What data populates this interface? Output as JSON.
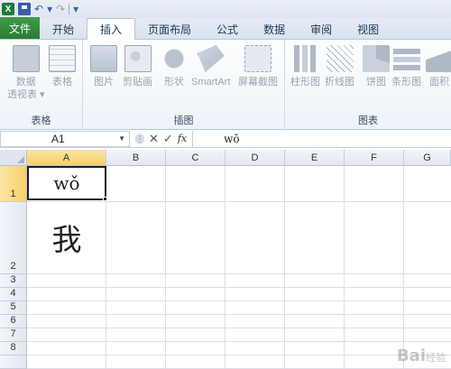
{
  "quick_access": {
    "undo": "↶",
    "redo": "↷",
    "customize": "▾"
  },
  "tabs": [
    {
      "label": "文件"
    },
    {
      "label": "开始"
    },
    {
      "label": "插入"
    },
    {
      "label": "页面布局"
    },
    {
      "label": "公式"
    },
    {
      "label": "数据"
    },
    {
      "label": "审阅"
    },
    {
      "label": "视图"
    }
  ],
  "ribbon": {
    "groups": {
      "tables": {
        "label": "表格",
        "pivot_line1": "数据",
        "pivot_line2": "透视表 ▾",
        "table": "表格"
      },
      "illustrations": {
        "label": "插图",
        "picture": "图片",
        "clipart": "剪贴画",
        "shapes": "形状",
        "smartart": "SmartArt",
        "screenshot": "屏幕截图"
      },
      "charts": {
        "label": "图表",
        "column": "柱形图",
        "line": "折线图",
        "pie": "饼图",
        "bar": "条形图",
        "area": "面积"
      }
    }
  },
  "formula_bar": {
    "name_box": "A1",
    "fx": "fx",
    "content": "wǒ"
  },
  "columns": [
    "A",
    "B",
    "C",
    "D",
    "E",
    "F",
    "G"
  ],
  "rows": [
    "1",
    "2",
    "3",
    "4",
    "5",
    "6",
    "7",
    "8"
  ],
  "cells": {
    "A1": "wǒ",
    "A2": "我"
  },
  "watermark": {
    "brand": "Bai",
    "suffix": "经验"
  }
}
